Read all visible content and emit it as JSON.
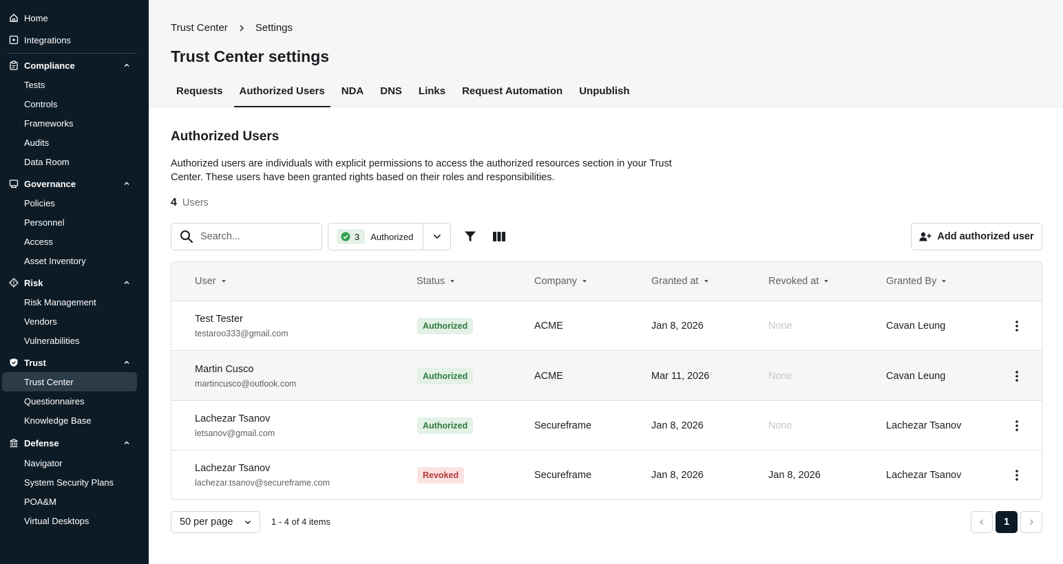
{
  "sidebar": {
    "home": "Home",
    "integrations": "Integrations",
    "compliance": {
      "label": "Compliance",
      "items": [
        "Tests",
        "Controls",
        "Frameworks",
        "Audits",
        "Data Room"
      ]
    },
    "governance": {
      "label": "Governance",
      "items": [
        "Policies",
        "Personnel",
        "Access",
        "Asset Inventory"
      ]
    },
    "risk": {
      "label": "Risk",
      "items": [
        "Risk Management",
        "Vendors",
        "Vulnerabilities"
      ]
    },
    "trust": {
      "label": "Trust",
      "items": [
        "Trust Center",
        "Questionnaires",
        "Knowledge Base"
      ],
      "active": "Trust Center"
    },
    "defense": {
      "label": "Defense",
      "items": [
        "Navigator",
        "System Security Plans",
        "POA&M",
        "Virtual Desktops"
      ]
    }
  },
  "breadcrumb": {
    "parent": "Trust Center",
    "current": "Settings"
  },
  "page_title": "Trust Center settings",
  "tabs": [
    {
      "label": "Requests"
    },
    {
      "label": "Authorized Users",
      "active": true
    },
    {
      "label": "NDA"
    },
    {
      "label": "DNS"
    },
    {
      "label": "Links"
    },
    {
      "label": "Request Automation"
    },
    {
      "label": "Unpublish"
    }
  ],
  "section": {
    "title": "Authorized Users",
    "description": "Authorized users are individuals with explicit permissions to access the authorized resources section in your Trust Center. These users have been granted rights based on their roles and responsibilities.",
    "count": "4",
    "count_label": "Users"
  },
  "toolbar": {
    "search_placeholder": "Search...",
    "status_filter_count": "3",
    "status_filter_label": "Authorized",
    "add_button": "Add authorized user"
  },
  "table": {
    "columns": [
      "User",
      "Status",
      "Company",
      "Granted at",
      "Revoked at",
      "Granted By"
    ],
    "rows": [
      {
        "name": "Test Tester",
        "email": "testaroo333@gmail.com",
        "status": "Authorized",
        "company": "ACME",
        "granted_at": "Jan 8, 2026",
        "revoked_at": "None",
        "granted_by": "Cavan Leung"
      },
      {
        "name": "Martin Cusco",
        "email": "martincusco@outlook.com",
        "status": "Authorized",
        "company": "ACME",
        "granted_at": "Mar 11, 2026",
        "revoked_at": "None",
        "granted_by": "Cavan Leung"
      },
      {
        "name": "Lachezar Tsanov",
        "email": "letsanov@gmail.com",
        "status": "Authorized",
        "company": "Secureframe",
        "granted_at": "Jan 8, 2026",
        "revoked_at": "None",
        "granted_by": "Lachezar Tsanov"
      },
      {
        "name": "Lachezar Tsanov",
        "email": "lachezar.tsanov@secureframe.com",
        "status": "Revoked",
        "company": "Secureframe",
        "granted_at": "Jan 8, 2026",
        "revoked_at": "Jan 8, 2026",
        "granted_by": "Lachezar Tsanov"
      }
    ]
  },
  "pagination": {
    "per_page": "50 per page",
    "range": "1 - 4 of 4 items",
    "current_page": "1"
  },
  "colors": {
    "sidebar_bg": "#0d1b26",
    "authorized_badge": "#e3f1e6",
    "revoked_badge": "#fbe3e3",
    "accent_check": "#2e9e4f"
  }
}
